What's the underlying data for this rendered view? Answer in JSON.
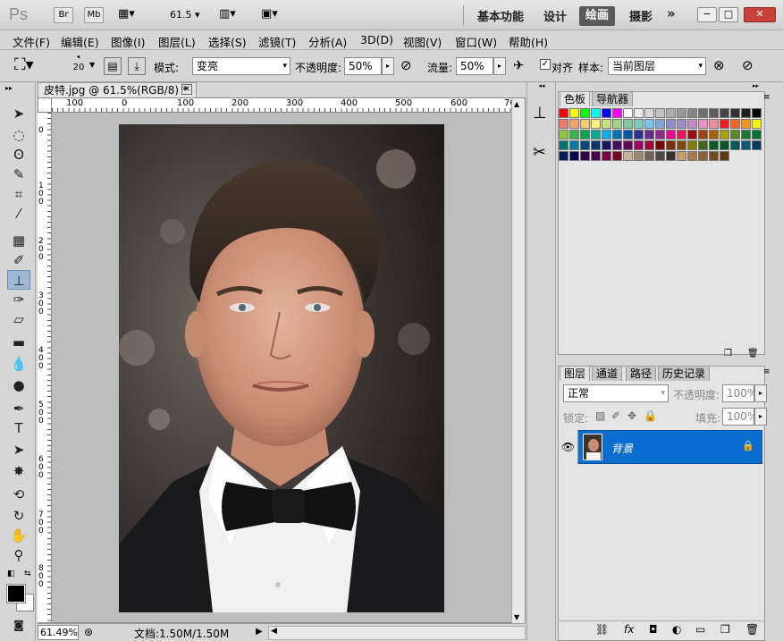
{
  "app": {
    "logo": "Ps",
    "bridge_label": "Br",
    "minibridge_label": "Mb",
    "zoom_value": "61.5",
    "workspaces": [
      "基本功能",
      "设计",
      "绘画",
      "摄影"
    ],
    "active_workspace": "绘画",
    "more_label": "»"
  },
  "menu": [
    "文件(F)",
    "编辑(E)",
    "图像(I)",
    "图层(L)",
    "选择(S)",
    "滤镜(T)",
    "分析(A)",
    "3D(D)",
    "视图(V)",
    "窗口(W)",
    "帮助(H)"
  ],
  "options": {
    "brush_size": "20",
    "mode_label": "模式:",
    "mode_value": "变亮",
    "opacity_label": "不透明度:",
    "opacity_value": "50%",
    "flow_label": "流量:",
    "flow_value": "50%",
    "align_label": "对齐",
    "align_checked": true,
    "sample_label": "样本:",
    "sample_value": "当前图层"
  },
  "document": {
    "tab_title": "皮特.jpg @ 61.5%(RGB/8) *",
    "ruler_h": [
      "100",
      "0",
      "100",
      "200",
      "300",
      "400",
      "500",
      "600",
      "70"
    ],
    "ruler_v": [
      "0",
      "100",
      "200",
      "300",
      "400",
      "500",
      "600",
      "700",
      "800"
    ],
    "zoom_status": "61.49%",
    "doc_info": "文档:1.50M/1.50M"
  },
  "swatches_panel": {
    "tabs": [
      "色板",
      "导航器"
    ],
    "colors": [
      "#ff0000",
      "#ffff00",
      "#00ff00",
      "#00ffff",
      "#0000ff",
      "#ff00ff",
      "#ffffff",
      "#ebebeb",
      "#d6d6d6",
      "#c2c2c2",
      "#adadad",
      "#999999",
      "#858585",
      "#707070",
      "#5c5c5c",
      "#474747",
      "#333333",
      "#1f1f1f",
      "#000000",
      "#f07a6e",
      "#f7a46d",
      "#fbc86e",
      "#fff57b",
      "#c8e07a",
      "#a0d28a",
      "#7ec89a",
      "#7cc9c0",
      "#75c7ef",
      "#7fa9dc",
      "#8b8ccb",
      "#a18bc8",
      "#c08cc6",
      "#ed8fc0",
      "#f18b9a",
      "#ee1d24",
      "#f26522",
      "#f7941d",
      "#fff200",
      "#8dc63f",
      "#39b54a",
      "#00a651",
      "#00a99d",
      "#00aeef",
      "#0072bc",
      "#0054a6",
      "#2e3192",
      "#662d91",
      "#92278f",
      "#ec008c",
      "#ed145b",
      "#9e0b0f",
      "#a0410d",
      "#a36209",
      "#aba000",
      "#598527",
      "#197b30",
      "#007236",
      "#00746b",
      "#0076a3",
      "#004a80",
      "#003471",
      "#1b1464",
      "#440e62",
      "#630460",
      "#9e005d",
      "#9e0039",
      "#790000",
      "#7b2e00",
      "#7d4900",
      "#827b00",
      "#406618",
      "#005e20",
      "#005826",
      "#005952",
      "#005b7f",
      "#003663",
      "#002157",
      "#0d004c",
      "#32004b",
      "#4b0049",
      "#7b0046",
      "#7a0026",
      "#c7b299",
      "#998675",
      "#736357",
      "#534741",
      "#37302d",
      "#c69c6d",
      "#a67c52",
      "#8c6239",
      "#754c24",
      "#603913"
    ]
  },
  "layers_panel": {
    "tabs": [
      "图层",
      "通道",
      "路径",
      "历史记录"
    ],
    "blend_mode": "正常",
    "opacity_label": "不透明度:",
    "opacity_value": "100%",
    "lock_label": "锁定:",
    "fill_label": "填充:",
    "fill_value": "100%",
    "layers": [
      {
        "name": "背景",
        "selected": true,
        "locked": true
      }
    ],
    "footer_icons": [
      "link-icon",
      "fx-icon",
      "mask-icon",
      "adjustment-icon",
      "group-icon",
      "new-layer-icon",
      "trash-icon"
    ]
  },
  "colors": {
    "accent": "#0a6ed1",
    "ui_bg": "#d6d6d6",
    "close": "#c9423a"
  }
}
